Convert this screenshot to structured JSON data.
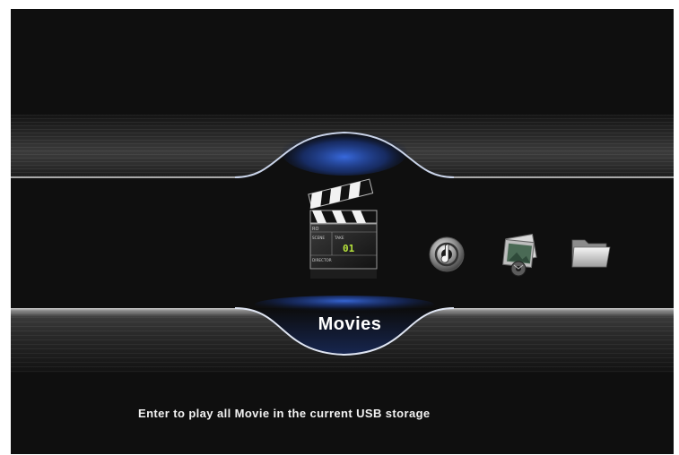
{
  "menu": {
    "selected_label": "Movies",
    "items": [
      {
        "id": "movies",
        "icon": "clapperboard-icon",
        "selected": true
      },
      {
        "id": "music",
        "icon": "music-disc-icon",
        "selected": false
      },
      {
        "id": "photos",
        "icon": "photos-icon",
        "selected": false
      },
      {
        "id": "files",
        "icon": "folder-icon",
        "selected": false
      }
    ]
  },
  "clapper": {
    "roll_label": "RO",
    "scene_label": "SCENE",
    "take_label": "TAKE",
    "take_value": "01",
    "director_label": "DIRECTOR"
  },
  "status": {
    "hint": "Enter to play all Movie in the current USB storage"
  },
  "colors": {
    "background": "#0f0f0f",
    "highlight_glow": "#2f5fd0",
    "text": "#ffffff"
  }
}
